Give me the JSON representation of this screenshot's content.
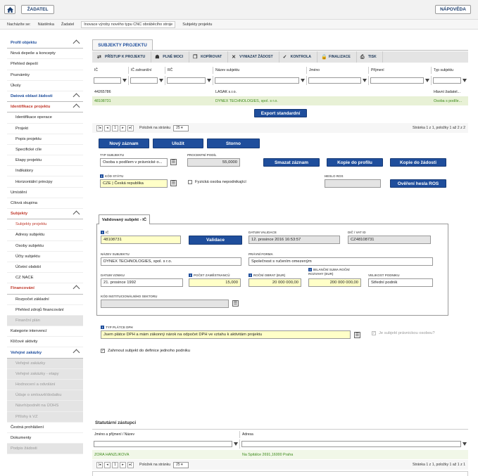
{
  "topbar": {
    "home_icon": "home-icon",
    "zadatel": "ŽADATEL",
    "napoveda": "NÁPOVĚDA"
  },
  "breadcrumb": {
    "label": "Nacházíte se:",
    "items": [
      "Nástěnka",
      "Žadatel",
      "Inovace výroby nového typu CNC obráběcího stroje",
      "Subjekty projektu"
    ]
  },
  "sidebar": {
    "items": [
      {
        "label": "Profil objektu",
        "type": "hdr",
        "chev": true
      },
      {
        "label": "Nová depeše a koncepty",
        "type": ""
      },
      {
        "label": "Přehled depeší",
        "type": ""
      },
      {
        "label": "Poznámky",
        "type": ""
      },
      {
        "label": "Úkoly",
        "type": ""
      },
      {
        "label": "Datová oblast žádosti",
        "type": "hdr",
        "chev": true
      },
      {
        "label": "Identifikace projektu",
        "type": "pink-h",
        "chev": true
      },
      {
        "label": "Identifikace operace",
        "type": "sub"
      },
      {
        "label": "Projekt",
        "type": "sub"
      },
      {
        "label": "Popis projektu",
        "type": "sub"
      },
      {
        "label": "Specifické cíle",
        "type": "sub"
      },
      {
        "label": "Etapy projektu",
        "type": "sub"
      },
      {
        "label": "Indikátory",
        "type": "sub"
      },
      {
        "label": "Horizontální principy",
        "type": "sub"
      },
      {
        "label": "Umístění",
        "type": ""
      },
      {
        "label": "Cílová skupina",
        "type": ""
      },
      {
        "label": "Subjekty",
        "type": "pink-h",
        "chev": true
      },
      {
        "label": "Subjekty projektu",
        "type": "sub act"
      },
      {
        "label": "Adresy subjektu",
        "type": "sub"
      },
      {
        "label": "Osoby subjektu",
        "type": "sub"
      },
      {
        "label": "Účty subjektu",
        "type": "sub"
      },
      {
        "label": "Účetní období",
        "type": "sub"
      },
      {
        "label": "CZ NACE",
        "type": "sub"
      },
      {
        "label": "Financování",
        "type": "pink-h",
        "chev": true
      },
      {
        "label": "Rozpočet základní",
        "type": "sub"
      },
      {
        "label": "Přehled zdrojů financování",
        "type": "sub"
      },
      {
        "label": "Finanční plán",
        "type": "sub dis"
      },
      {
        "label": "Kategorie intervencí",
        "type": ""
      },
      {
        "label": "Klíčové aktivity",
        "type": ""
      },
      {
        "label": "Veřejné zakázky",
        "type": "hdr",
        "chev": true
      },
      {
        "label": "Veřejné zakázky",
        "type": "sub dis"
      },
      {
        "label": "Veřejné zakázky - etapy",
        "type": "sub dis"
      },
      {
        "label": "Hodnocení a odvolání",
        "type": "sub dis"
      },
      {
        "label": "Údaje o smlouvě/dodatku",
        "type": "sub dis"
      },
      {
        "label": "Návrh/podnět na ÚOHS",
        "type": "sub dis"
      },
      {
        "label": "Přílohy k VZ",
        "type": "sub dis"
      },
      {
        "label": "Čestná prohlášení",
        "type": ""
      },
      {
        "label": "Dokumenty",
        "type": ""
      },
      {
        "label": "Podpis žádosti",
        "type": "dis"
      }
    ]
  },
  "tab": "SUBJEKTY PROJEKTU",
  "toolbar": [
    {
      "icon": "transfer-icon",
      "label": "PŘÍSTUP K PROJEKTU"
    },
    {
      "icon": "user-icon",
      "label": "PLNÉ MOCI"
    },
    {
      "icon": "copy-icon",
      "label": "KOPÍROVAT"
    },
    {
      "icon": "x-icon",
      "label": "VYMAZAT ŽÁDOST"
    },
    {
      "icon": "check-icon",
      "label": "KONTROLA"
    },
    {
      "icon": "lock-icon",
      "label": "FINALIZACE"
    },
    {
      "icon": "print-icon",
      "label": "TISK"
    }
  ],
  "grid": {
    "columns": [
      "IČ",
      "IČ zahraniční",
      "RČ",
      "Název subjektu",
      "Jméno",
      "Příjmení",
      "Typ subjektu"
    ],
    "rows": [
      [
        "44265786",
        "",
        "",
        "LASAK s.r.o.",
        "",
        "",
        "Hlavní žadatel..."
      ],
      [
        "48108731",
        "",
        "",
        "DYNEX TECHNOLOGIES, spol. s r.o.",
        "",
        "",
        "Osoba s podíle..."
      ]
    ],
    "export": "Export standardní",
    "pager": {
      "per_page_label": "Položek na stránku",
      "per_page": "25",
      "summary": "Stránka 1 z 1, položky 1 až 2 z 2",
      "page": "1"
    }
  },
  "actions": {
    "new": "Nový záznam",
    "save": "Uložit",
    "cancel": "Storno",
    "delete": "Smazat záznam",
    "copy_profile": "Kopie do profilu",
    "copy_request": "Kopie do žádosti",
    "verify_ros": "Ověření hesla ROS",
    "validate": "Validace"
  },
  "form": {
    "typ_subjektu_label": "TYP SUBJEKTU",
    "typ_subjektu": "Osoba s podílem v právnické o...",
    "procentni_podil_label": "PROCENTNÍ PODÍL",
    "procentni_podil": "55,0000",
    "kod_statu_label": "KÓD STÁTU",
    "kod_statu": "CZE | Česká republika",
    "fyzicka_label": "Fyzická osoba nepodnikající",
    "heslo_ros_label": "HESLO ROS",
    "validated_tab": "Validovaný subjekt - IČ",
    "ic_label": "IČ",
    "ic": "48108731",
    "datum_validace_label": "DATUM VALIDACE",
    "datum_validace": "12. prosince 2016 16:53:57",
    "dic_label": "DIČ / VAT ID",
    "dic": "CZ48108731",
    "nazev_label": "NÁZEV SUBJEKTU",
    "nazev": "DYNEX TECHNOLOGIES, spol. s r.o.",
    "pravni_forma_label": "PRÁVNÍ FORMA",
    "pravni_forma": "Společnost s ručením omezeným",
    "datum_vzniku_label": "DATUM VZNIKU",
    "datum_vzniku": "21. prosince 1992",
    "pocet_zam_label": "POČET ZAMĚSTNANCŮ",
    "pocet_zam": "15,000",
    "obrat_label": "ROČNÍ OBRAT (EUR)",
    "obrat": "20 000 000,00",
    "bilancni_label": "BILANČNÍ SUMA ROČNÍ ROZVAHY (EUR)",
    "bilancni": "200 000 000,00",
    "velikost_label": "VELIKOST PODNIKU",
    "velikost": "Střední podnik",
    "kod_inst_label": "KÓD INSTITUCIONÁLNÍHO SEKTORU",
    "typ_dph_label": "TYP PLÁTCE DPH",
    "typ_dph": "Jsem plátce DPH a mám zákonný nárok na odpočet DPH ve vztahu k aktivitám projektu",
    "pravnicka_label": "Je subjekt právnickou osobou?",
    "zahrnout_label": "Zahrnout subjekt do definice jednoho podniku"
  },
  "statutory": {
    "title": "Statutární zástupci",
    "columns": [
      "Jméno a příjmení / Název",
      "Adresa"
    ],
    "rows": [
      [
        "ZORA HANZLÍKOVÁ",
        "Na Špitálce 2691,16000 Praha"
      ]
    ],
    "pager": {
      "per_page_label": "Položek na stránku",
      "per_page": "25",
      "summary": "Stránka 1 z 1, položky 1 až 1 z 1",
      "page": "1"
    }
  }
}
